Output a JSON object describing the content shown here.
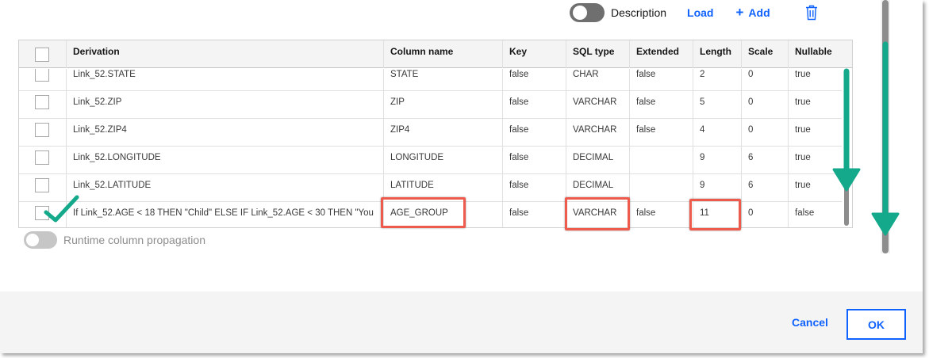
{
  "toolbar": {
    "description_label": "Description",
    "load_label": "Load",
    "add_label": "Add",
    "add_icon": "+"
  },
  "table": {
    "columns": [
      "Derivation",
      "Column name",
      "Key",
      "SQL type",
      "Extended",
      "Length",
      "Scale",
      "Nullable"
    ],
    "rows": [
      {
        "derivation": "Link_52.STATE",
        "column_name": "STATE",
        "key": "false",
        "sql_type": "CHAR",
        "extended": "false",
        "length": "2",
        "scale": "0",
        "nullable": "true"
      },
      {
        "derivation": "Link_52.ZIP",
        "column_name": "ZIP",
        "key": "false",
        "sql_type": "VARCHAR",
        "extended": "false",
        "length": "5",
        "scale": "0",
        "nullable": "true"
      },
      {
        "derivation": "Link_52.ZIP4",
        "column_name": "ZIP4",
        "key": "false",
        "sql_type": "VARCHAR",
        "extended": "false",
        "length": "4",
        "scale": "0",
        "nullable": "true"
      },
      {
        "derivation": "Link_52.LONGITUDE",
        "column_name": "LONGITUDE",
        "key": "false",
        "sql_type": "DECIMAL",
        "extended": "",
        "length": "9",
        "scale": "6",
        "nullable": "true"
      },
      {
        "derivation": "Link_52.LATITUDE",
        "column_name": "LATITUDE",
        "key": "false",
        "sql_type": "DECIMAL",
        "extended": "",
        "length": "9",
        "scale": "6",
        "nullable": "true"
      },
      {
        "derivation": "If Link_52.AGE < 18 THEN \"Child\" ELSE IF Link_52.AGE < 30 THEN \"You",
        "column_name": "AGE_GROUP",
        "key": "false",
        "sql_type": "VARCHAR",
        "extended": "false",
        "length": "11",
        "scale": "0",
        "nullable": "false"
      }
    ]
  },
  "runtime": {
    "label": "Runtime column propagation"
  },
  "footer": {
    "cancel_label": "Cancel",
    "ok_label": "OK"
  },
  "colors": {
    "accent": "#0f62fe",
    "highlight": "#ee5b4c",
    "annotation": "#14a98b"
  }
}
